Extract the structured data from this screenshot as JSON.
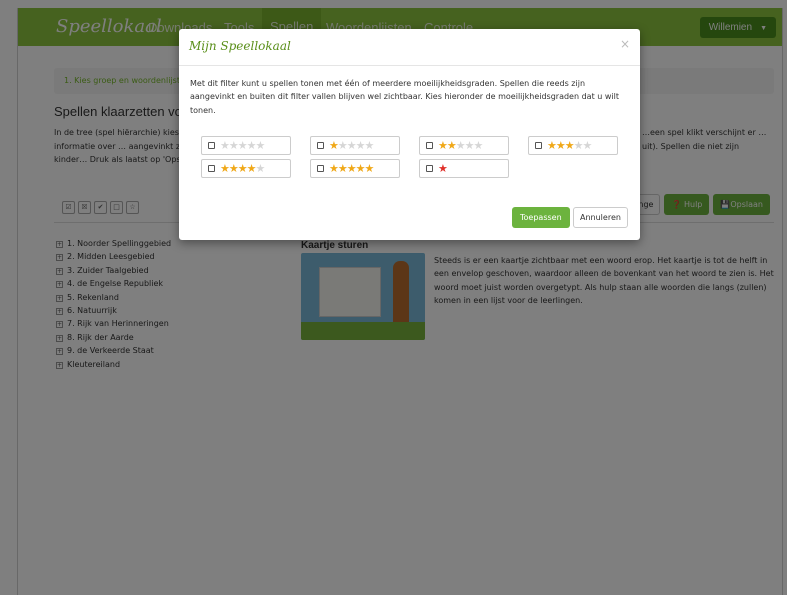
{
  "app": {
    "logo": "Speellokaal",
    "nav": [
      "Downloads",
      "Tools",
      "Spellen",
      "Woordenlijsten",
      "Controle"
    ],
    "active_nav_index": 2,
    "user": "Willemien",
    "colors": {
      "brand": "#8cc53f",
      "button": "#6cb33e",
      "star": "#f0a818",
      "red_star": "#e0302a"
    }
  },
  "page": {
    "breadcrumb": "1. Kies groep en woordenlijst",
    "title": "Spellen klaarzetten voor",
    "intro": "In de tree (spel hiërarchie) kies… rechts (extra) informatie over … aangevinkt zijn voor de kinder… Druk als laatst op 'Opslaan'.",
    "intro_right": "…een spel klikt verschijnt er …uit). Spellen die niet zijn",
    "tool_icons": [
      "check-all-icon",
      "uncheck-icon",
      "check-icon",
      "square-icon",
      "star-icon"
    ],
    "buttons": {
      "change": "…nge",
      "help": "Hulp",
      "save": "Opslaan"
    }
  },
  "tree": [
    "1. Noorder Spellinggebied",
    "2. Midden Leesgebied",
    "3. Zuider Taalgebied",
    "4. de Engelse Republiek",
    "5. Rekenland",
    "6. Natuurrijk",
    "7. Rijk van Herinneringen",
    "8. Rijk der Aarde",
    "9. de Verkeerde Staat",
    "Kleutereiland"
  ],
  "game": {
    "title": "Kaartje sturen",
    "description": "Steeds is er een kaartje zichtbaar met een woord erop. Het kaartje is tot de helft in een envelop geschoven, waardoor alleen de bovenkant van het woord te zien is. Het woord moet juist worden overgetypt. Als hulp staan alle woorden die langs (zullen) komen in een lijst voor de leerlingen."
  },
  "modal": {
    "title": "Mijn Speellokaal",
    "close": "×",
    "body": "Met dit filter kunt u spellen tonen met één of meerdere moeilijkheidsgraden. Spellen die reeds zijn aangevinkt en buiten dit filter vallen blijven wel zichtbaar. Kies hieronder de moeilijkheidsgraden dat u wilt tonen.",
    "filters": [
      {
        "level": 0,
        "of": 5,
        "checked": false
      },
      {
        "level": 1,
        "of": 5,
        "checked": false
      },
      {
        "level": 2,
        "of": 5,
        "checked": false
      },
      {
        "level": 3,
        "of": 5,
        "checked": false
      },
      {
        "level": 4,
        "of": 5,
        "checked": false
      },
      {
        "level": 5,
        "of": 5,
        "checked": false
      },
      {
        "level": "special-red",
        "of": 1,
        "checked": false
      }
    ],
    "apply": "Toepassen",
    "cancel": "Annuleren"
  }
}
